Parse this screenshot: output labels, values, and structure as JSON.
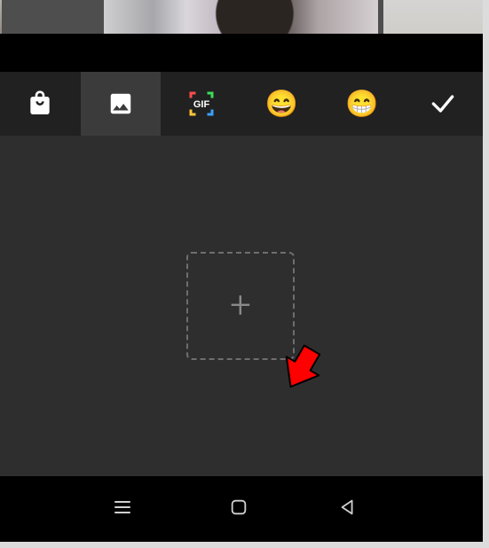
{
  "toolbar": {
    "items": [
      {
        "id": "store",
        "name": "store-icon",
        "selected": false
      },
      {
        "id": "gallery",
        "name": "gallery-icon",
        "selected": true
      },
      {
        "id": "gif",
        "name": "gif-icon",
        "selected": false,
        "label": "GIF"
      },
      {
        "id": "emoji",
        "name": "emoji-grin-icon",
        "selected": false,
        "glyph": "😄"
      },
      {
        "id": "emoji2",
        "name": "emoji-beam-icon",
        "selected": false,
        "glyph": "😁"
      },
      {
        "id": "confirm",
        "name": "check-icon",
        "selected": false
      }
    ]
  },
  "content": {
    "add_tile": {
      "label": "+"
    }
  },
  "annotation": {
    "arrow_color": "#ff0000"
  },
  "navbar": {
    "recent": "recent-apps",
    "home": "home",
    "back": "back"
  }
}
